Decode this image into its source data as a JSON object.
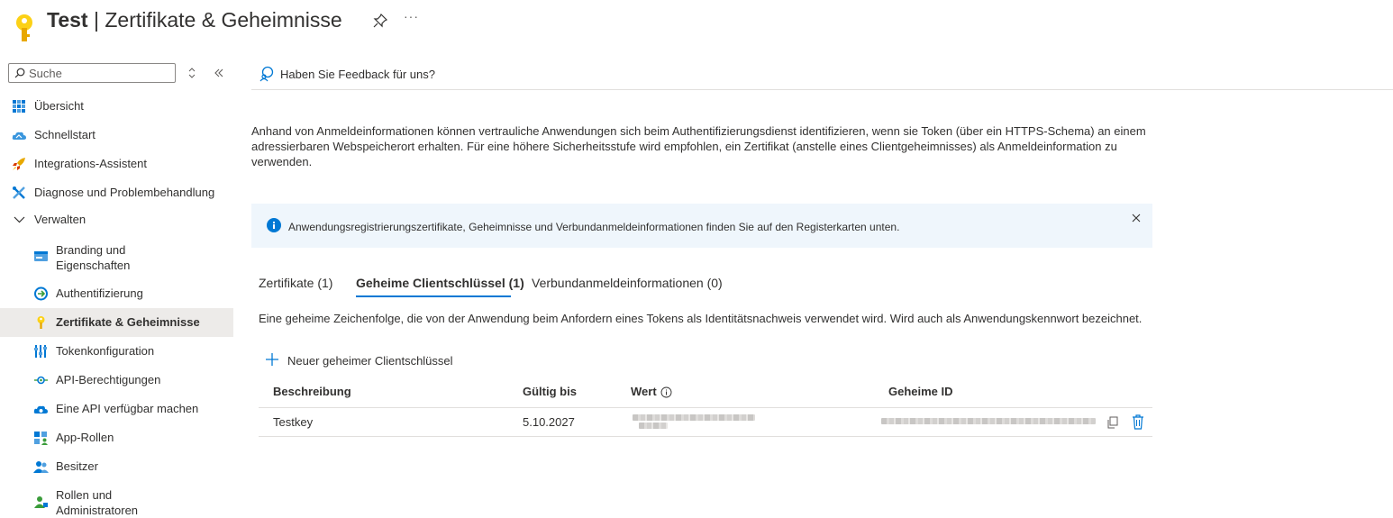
{
  "header": {
    "app_name": "Test",
    "separator": " | ",
    "page_title": "Zertifikate & Geheimnisse",
    "more": "···"
  },
  "sidebar": {
    "search_placeholder": "Suche",
    "items": [
      {
        "label": "Übersicht",
        "icon": "overview-grid-icon"
      },
      {
        "label": "Schnellstart",
        "icon": "cloud-quickstart-icon"
      },
      {
        "label": "Integrations-Assistent",
        "icon": "rocket-icon"
      },
      {
        "label": "Diagnose und Problembehandlung",
        "icon": "wrench-icon"
      },
      {
        "label": "Verwalten",
        "icon": "chevron-down-icon"
      },
      {
        "label": "Branding und",
        "label2": "Eigenschaften",
        "icon": "branding-card-icon"
      },
      {
        "label": "Authentifizierung",
        "icon": "authentication-icon"
      },
      {
        "label": "Zertifikate & Geheimnisse",
        "icon": "key-icon"
      },
      {
        "label": "Tokenkonfiguration",
        "icon": "token-config-icon"
      },
      {
        "label": "API-Berechtigungen",
        "icon": "api-permissions-icon"
      },
      {
        "label": "Eine API verfügbar machen",
        "icon": "expose-api-cloud-icon"
      },
      {
        "label": "App-Rollen",
        "icon": "app-roles-icon"
      },
      {
        "label": "Besitzer",
        "icon": "owners-icon"
      },
      {
        "label": "Rollen und",
        "label2": "Administratoren",
        "icon": "roles-admins-icon"
      }
    ]
  },
  "main": {
    "feedback": "Haben Sie Feedback für uns?",
    "description": "Anhand von Anmeldeinformationen können vertrauliche Anwendungen sich beim Authentifizierungsdienst identifizieren, wenn sie Token (über ein HTTPS-Schema) an einem adressierbaren Webspeicherort erhalten. Für eine höhere Sicherheitsstufe wird empfohlen, ein Zertifikat (anstelle eines Clientgeheimnisses) als Anmeldeinformation zu verwenden.",
    "info_banner": "Anwendungsregistrierungszertifikate, Geheimnisse und Verbundanmeldeinformationen finden Sie auf den Registerkarten unten.",
    "tabs": [
      {
        "label": "Zertifikate (1)"
      },
      {
        "label": "Geheime Clientschlüssel (1)",
        "active": true
      },
      {
        "label": "Verbundanmeldeinformationen (0)"
      }
    ],
    "tab_description": "Eine geheime Zeichenfolge, die von der Anwendung beim Anfordern eines Tokens als Identitätsnachweis verwendet wird. Wird auch als Anwendungskennwort bezeichnet.",
    "new_secret_button": "Neuer geheimer Clientschlüssel",
    "table": {
      "headers": [
        "Beschreibung",
        "Gültig bis",
        "Wert",
        "Geheime ID"
      ],
      "rows": [
        {
          "description": "Testkey",
          "expires": "5.10.2027"
        }
      ]
    }
  },
  "colors": {
    "accent": "#0078d4",
    "key_yellow": "#fcd116",
    "active_nav_bg": "#edebe9",
    "info_bg": "#eff6fc"
  }
}
